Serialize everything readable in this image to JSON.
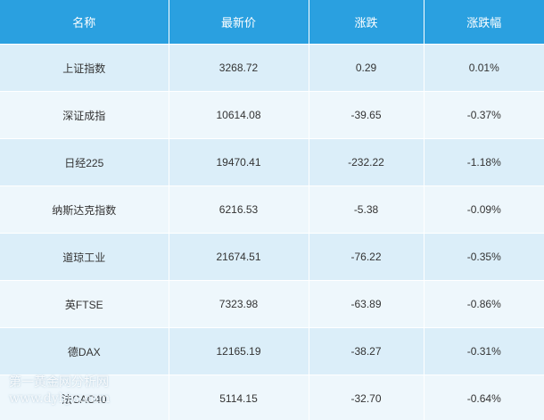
{
  "table": {
    "headers": [
      "名称",
      "最新价",
      "涨跌",
      "涨跌幅"
    ],
    "rows": [
      [
        "上证指数",
        "3268.72",
        "0.29",
        "0.01%"
      ],
      [
        "深证成指",
        "10614.08",
        "-39.65",
        "-0.37%"
      ],
      [
        "日经225",
        "19470.41",
        "-232.22",
        "-1.18%"
      ],
      [
        "纳斯达克指数",
        "6216.53",
        "-5.38",
        "-0.09%"
      ],
      [
        "道琼工业",
        "21674.51",
        "-76.22",
        "-0.35%"
      ],
      [
        "英FTSE",
        "7323.98",
        "-63.89",
        "-0.86%"
      ],
      [
        "德DAX",
        "12165.19",
        "-38.27",
        "-0.31%"
      ],
      [
        "法CAC40",
        "5114.15",
        "-32.70",
        "-0.64%"
      ]
    ]
  },
  "watermark": {
    "line1": "第一黄金网分析网",
    "line2": "www.dyhjw.com"
  },
  "colors": {
    "header_bg": "#2aa0e0",
    "row_odd": "#dbeef9",
    "row_even": "#eef7fc"
  }
}
